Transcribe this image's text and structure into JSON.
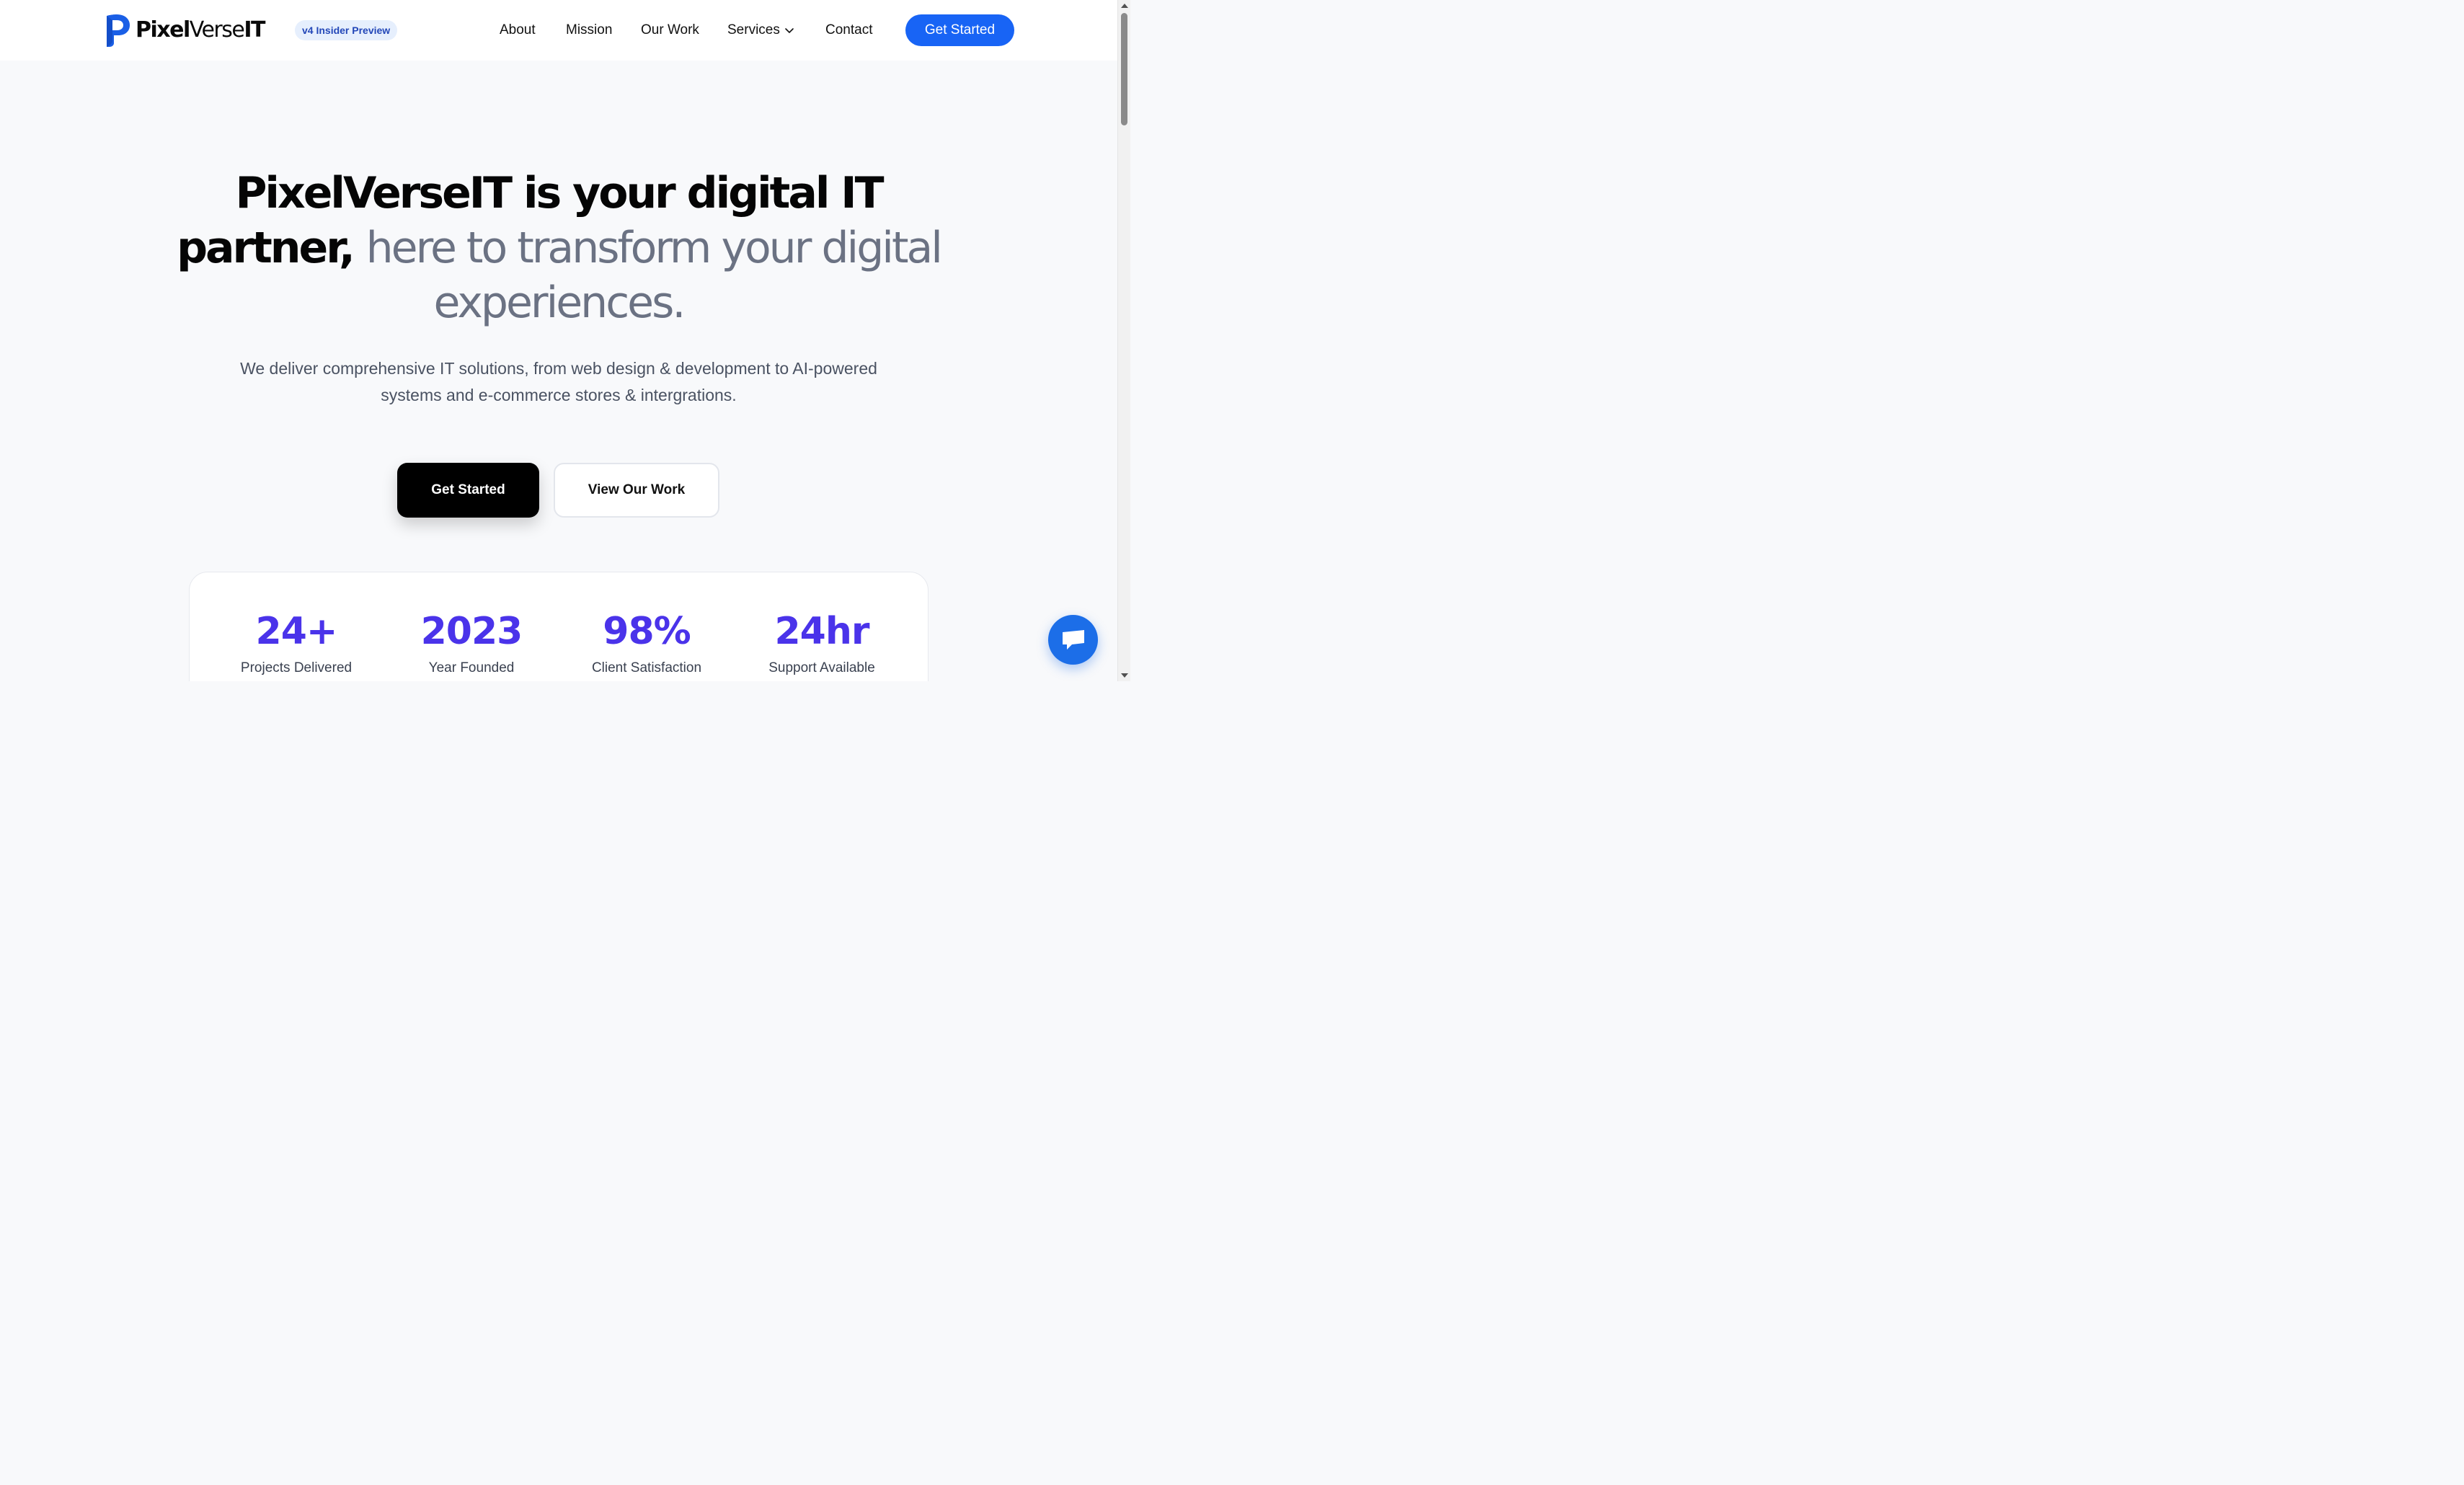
{
  "header": {
    "brand_bold": "Pixel",
    "brand_light": "Verse",
    "brand_tail": "IT",
    "badge": "v4 Insider Preview",
    "nav": {
      "about": "About",
      "mission": "Mission",
      "our_work": "Our Work",
      "services": "Services",
      "contact": "Contact"
    },
    "cta": "Get Started"
  },
  "hero": {
    "title_strong_1": "PixelVerseIT is your digital IT",
    "title_strong_2": "partner,",
    "title_soft": "here to transform your digital experiences.",
    "subtitle": "We deliver comprehensive IT solutions, from web design & development to AI-powered systems and e-commerce stores & intergrations.",
    "primary_button": "Get Started",
    "secondary_button": "View Our Work"
  },
  "stats": [
    {
      "value": "24+",
      "label": "Projects Delivered"
    },
    {
      "value": "2023",
      "label": "Year Founded"
    },
    {
      "value": "98%",
      "label": "Client Satisfaction"
    },
    {
      "value": "24hr",
      "label": "Support Available"
    }
  ],
  "colors": {
    "accent_blue": "#1864f5",
    "stat_purple": "#4a33ea",
    "chat_blue": "#1c6ee8"
  },
  "icons": {
    "logo": "pixelverse-logo-icon",
    "services_dropdown": "chevron-down-icon",
    "chat": "chat-icon"
  }
}
